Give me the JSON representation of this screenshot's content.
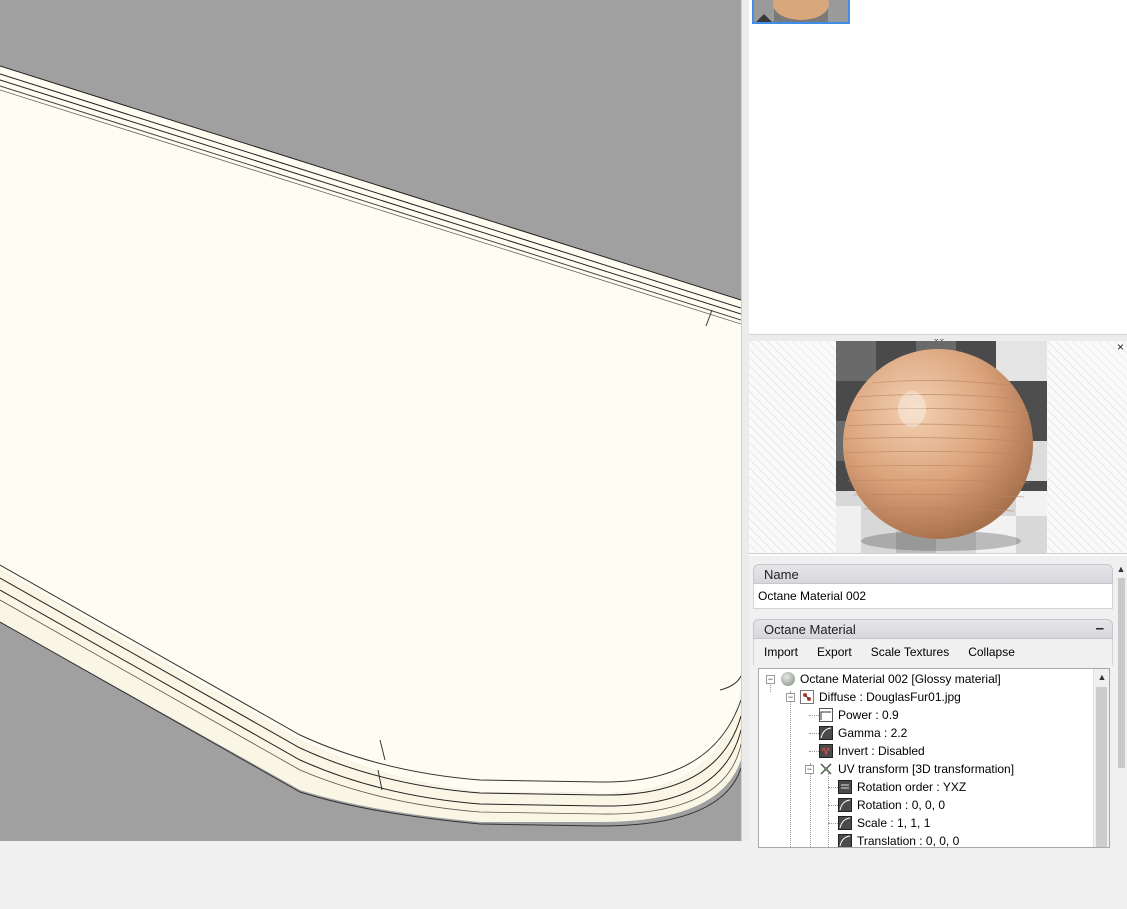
{
  "thumbnails": {
    "selected_material": "wood-sphere-thumbnail"
  },
  "preview": {
    "close_label": "×",
    "grip_label": "⌄⌄"
  },
  "name_section": {
    "header": "Name",
    "value": "Octane Material 002"
  },
  "octane_section": {
    "header": "Octane Material",
    "collapse_symbol": "–",
    "toolbar": [
      "Import",
      "Export",
      "Scale Textures",
      "Collapse"
    ]
  },
  "tree": {
    "root": {
      "label": "Octane Material 002  [Glossy material]",
      "icon": "sphere-icon"
    },
    "diffuse": {
      "label": "Diffuse : DouglasFur01.jpg",
      "icon": "image-texture-icon"
    },
    "power": {
      "label": "Power : 0.9",
      "icon": "curve-icon"
    },
    "gamma": {
      "label": "Gamma : 2.2",
      "icon": "curve-icon"
    },
    "invert": {
      "label": "Invert : Disabled",
      "icon": "toggle-icon"
    },
    "uv_transform": {
      "label": "UV transform  [3D transformation]",
      "icon": "transform-icon"
    },
    "rotation_order": {
      "label": "Rotation order : YXZ",
      "icon": "enum-icon"
    },
    "rotation": {
      "label": "Rotation : 0, 0, 0",
      "icon": "curve-icon"
    },
    "scale": {
      "label": "Scale : 1, 1, 1",
      "icon": "curve-icon"
    },
    "translation": {
      "label": "Translation : 0, 0, 0",
      "icon": "curve-icon"
    }
  },
  "colors": {
    "viewport_bg": "#a0a0a0",
    "surface": "#fffdf2",
    "selection": "#3d8ee8",
    "section_header": "#dcdce2"
  }
}
